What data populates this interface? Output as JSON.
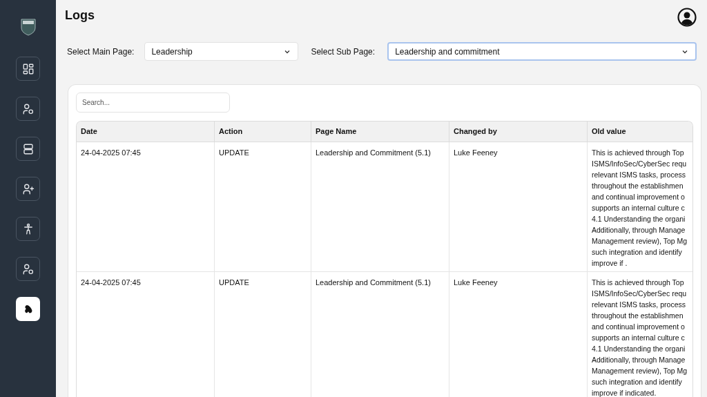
{
  "sidebar": {
    "items": [
      {
        "selected": false
      },
      {
        "selected": false
      },
      {
        "selected": false
      },
      {
        "selected": false
      },
      {
        "selected": false
      },
      {
        "selected": false
      },
      {
        "selected": true
      }
    ]
  },
  "page": {
    "title": "Logs"
  },
  "filters": [
    {
      "label": "Select Main Page:",
      "value": "Leadership",
      "focused": false
    },
    {
      "label": "Select Sub Page:",
      "value": "Leadership and commitment",
      "focused": true
    }
  ],
  "search": {
    "placeholder": "Search..."
  },
  "table": {
    "columns": [
      "Date",
      "Action",
      "Page Name",
      "Changed by",
      "Old value"
    ],
    "rows": [
      {
        "date": "24-04-2025 07:45",
        "action": "UPDATE",
        "page_name": "Leadership and Commitment (5.1)",
        "changed_by": "Luke Feeney",
        "old_value": [
          "This is achieved through Top",
          "ISMS/InfoSec/CyberSec requ",
          "relevant ISMS tasks, process",
          "throughout the establishmen",
          "and continual improvement o",
          "supports an internal culture c",
          "4.1 Understanding the organi",
          "Additionally, through Manage",
          "Management review), Top Mg",
          "such integration and identify",
          "improve if ."
        ]
      },
      {
        "date": "24-04-2025 07:45",
        "action": "UPDATE",
        "page_name": "Leadership and Commitment (5.1)",
        "changed_by": "Luke Feeney",
        "old_value": [
          "This is achieved through Top",
          "ISMS/InfoSec/CyberSec requ",
          "relevant ISMS tasks, process",
          "throughout the establishmen",
          "and continual improvement o",
          "supports an internal culture c",
          "4.1 Understanding the organi",
          "Additionally, through Manage",
          "Management review), Top Mg",
          "such integration and identify",
          "improve if indicated."
        ]
      }
    ]
  }
}
